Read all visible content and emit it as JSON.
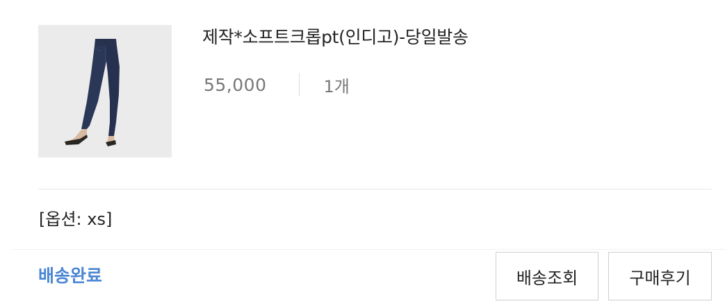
{
  "product": {
    "title": "제작*소프트크롭pt(인디고)-당일발송",
    "price": "55,000",
    "quantity": "1개",
    "image_icon": "product-thumbnail-jeans"
  },
  "option": {
    "text": "[옵션: xs]"
  },
  "order": {
    "status": "배송완료",
    "status_color": "#4a86d3"
  },
  "actions": {
    "track_label": "배송조회",
    "review_label": "구매후기"
  }
}
